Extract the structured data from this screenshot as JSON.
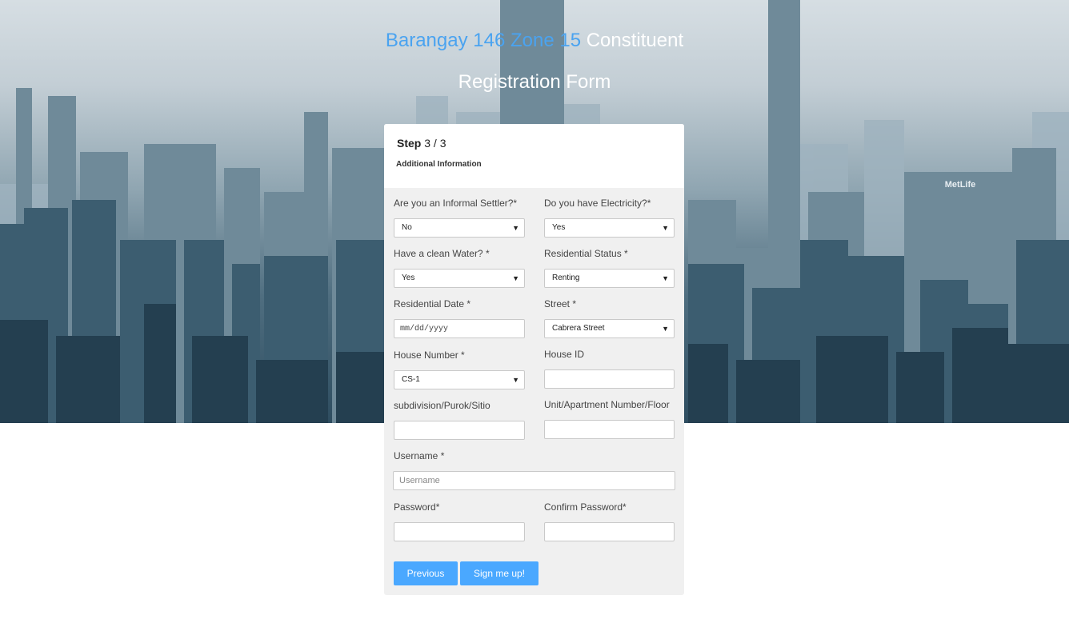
{
  "header": {
    "title_accent": "Barangay 146 Zone 15",
    "title_rest": "Constituent",
    "title_line2": "Registration Form"
  },
  "form": {
    "step_label": "Step",
    "step_value": "3 / 3",
    "section": "Additional Information",
    "fields": {
      "informal_settler": {
        "label": "Are you an Informal Settler?*",
        "value": "No"
      },
      "electricity": {
        "label": "Do you have Electricity?*",
        "value": "Yes"
      },
      "clean_water": {
        "label": "Have a clean Water? *",
        "value": "Yes"
      },
      "residential_status": {
        "label": "Residential Status *",
        "value": "Renting"
      },
      "residential_date": {
        "label": "Residential Date *",
        "placeholder": "mm/dd/yyyy"
      },
      "street": {
        "label": "Street *",
        "value": "Cabrera Street"
      },
      "house_number": {
        "label": "House Number *",
        "value": "CS-1"
      },
      "house_id": {
        "label": "House ID",
        "value": ""
      },
      "subdivision": {
        "label": "subdivision/Purok/Sitio",
        "value": ""
      },
      "unit": {
        "label": "Unit/Apartment Number/Floor",
        "value": ""
      },
      "username": {
        "label": "Username *",
        "placeholder": "Username"
      },
      "password": {
        "label": "Password*",
        "value": ""
      },
      "confirm_password": {
        "label": "Confirm Password*",
        "value": ""
      }
    },
    "buttons": {
      "previous": "Previous",
      "submit": "Sign me up!"
    }
  },
  "icons": {
    "dropdown": "caret-down-icon"
  },
  "colors": {
    "accent": "#4aa3f0",
    "button": "#4aa8ff",
    "card_bg": "#f0f0f0"
  }
}
